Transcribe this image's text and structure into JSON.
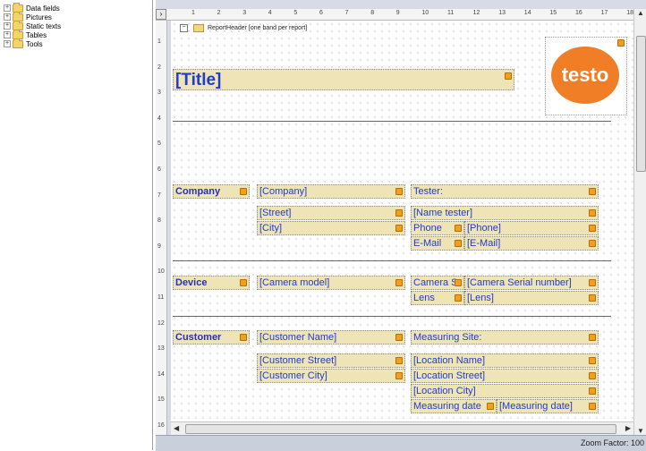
{
  "tree": {
    "items": [
      {
        "label": "Data fields",
        "icon": "folder-icon"
      },
      {
        "label": "Pictures",
        "icon": "folder-icon"
      },
      {
        "label": "Static texts",
        "icon": "folder-icon"
      },
      {
        "label": "Tables",
        "icon": "folder-icon"
      },
      {
        "label": "Tools",
        "icon": "folder-icon"
      }
    ]
  },
  "band": {
    "label": "ReportHeader [one band per report]"
  },
  "logo": {
    "text": "testo",
    "color": "#f07e26"
  },
  "ruler": {
    "top": [
      "1",
      "2",
      "3",
      "4",
      "5",
      "6",
      "7",
      "8",
      "9",
      "10",
      "11",
      "12",
      "13",
      "14",
      "15",
      "16",
      "17",
      "18"
    ],
    "left": [
      "1",
      "2",
      "3",
      "4",
      "5",
      "6",
      "7",
      "8",
      "9",
      "10",
      "11",
      "12",
      "13",
      "14",
      "15",
      "16"
    ]
  },
  "fields": {
    "title": "[Title]",
    "company_label": "Company",
    "company": "[Company]",
    "street": "[Street]",
    "city": "[City]",
    "tester_label": "Tester:",
    "name_tester": "[Name tester]",
    "phone_label": "Phone",
    "phone": "[Phone]",
    "email_label": "E-Mail",
    "email": "[E-Mail]",
    "device_label": "Device",
    "camera_model": "[Camera model]",
    "camera_sn_label": "Camera S",
    "camera_sn": "[Camera Serial number]",
    "lens_label": "Lens",
    "lens": "[Lens]",
    "customer_label": "Customer",
    "customer_name": "[Customer Name]",
    "customer_street": "[Customer Street]",
    "customer_city": "[Customer City]",
    "measuring_site_label": "Measuring Site:",
    "location_name": "[Location Name]",
    "location_street": "[Location Street]",
    "location_city": "[Location City]",
    "measuring_date_label": "Measuring date",
    "measuring_date": "[Measuring date]"
  },
  "status": {
    "zoom": "Zoom Factor: 100"
  },
  "colors": {
    "field_bg": "#efe4b6",
    "field_text": "#1e3ccf",
    "marker": "#f0a020"
  }
}
